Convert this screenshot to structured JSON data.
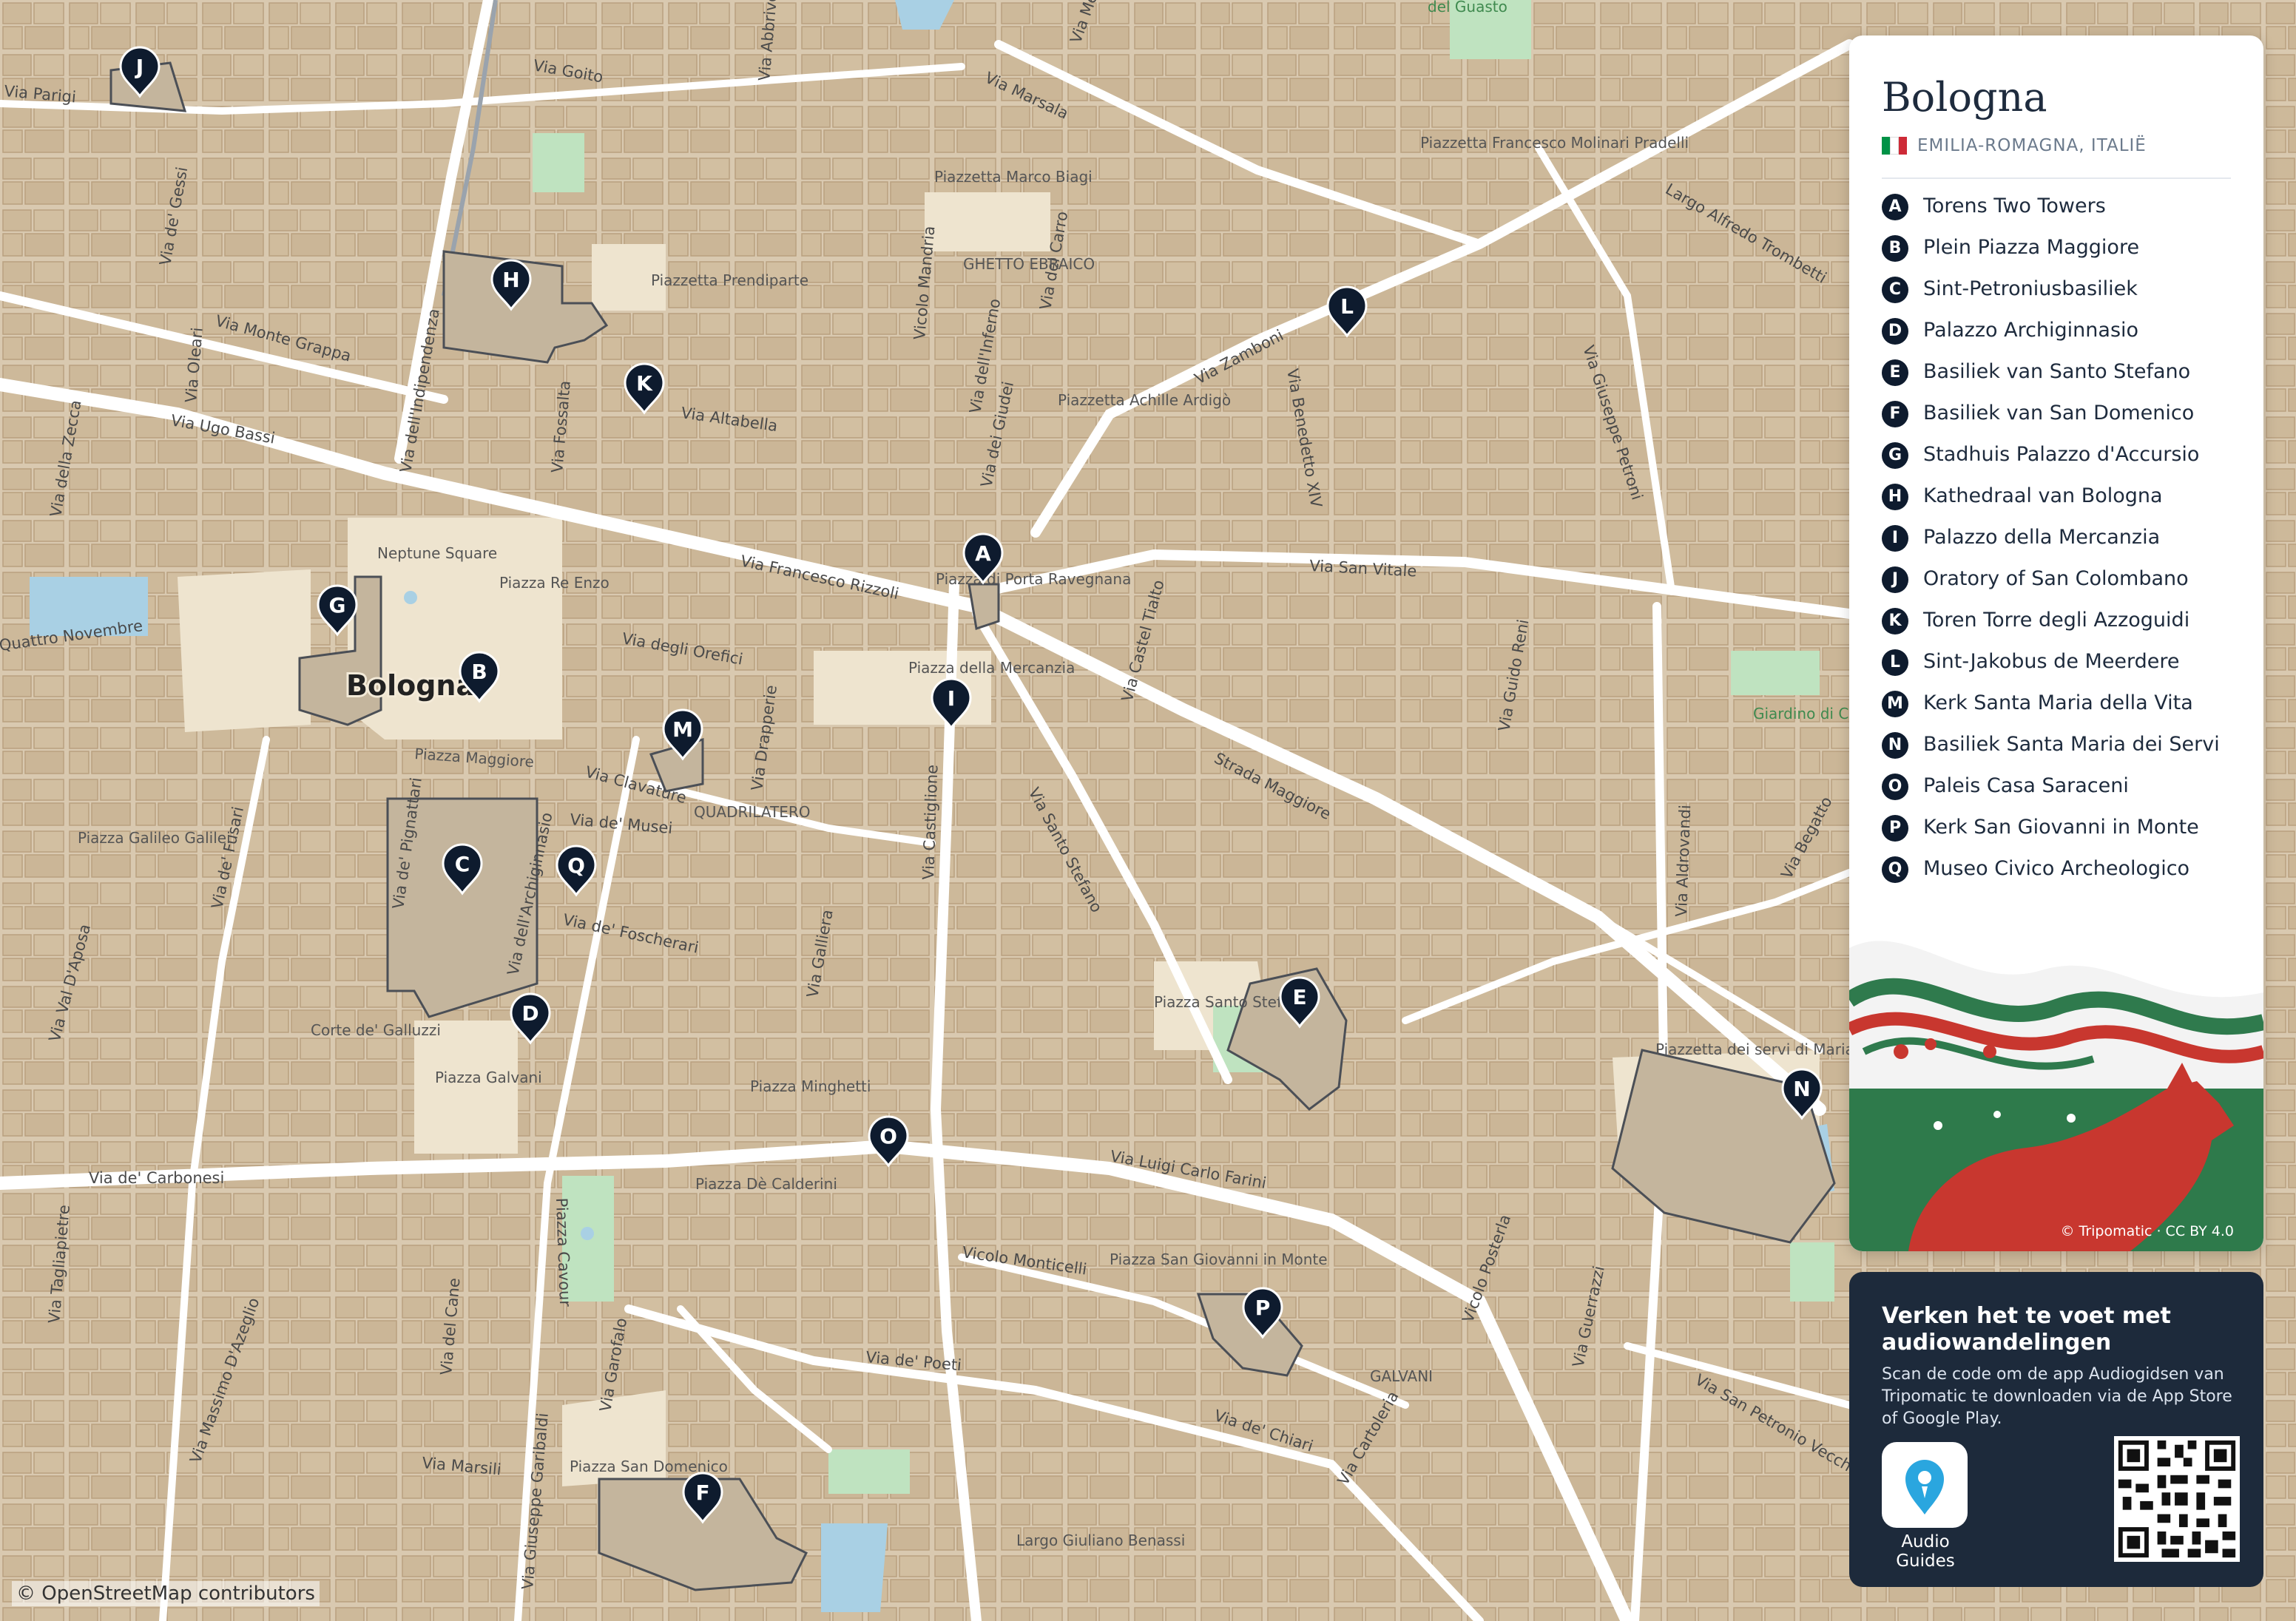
{
  "map": {
    "city_label": "Bologna",
    "attribution": "© OpenStreetMap contributors",
    "colors": {
      "land": "#d9c9b0",
      "street": "#ffffff",
      "building": "#c9b597",
      "park": "#bfe3c0",
      "water": "#a9d0e4",
      "marker": "#0e1b2e"
    },
    "street_labels": [
      "Via Goito",
      "Via Marsala",
      "Via Zamboni",
      "Via Altabella",
      "Via Ugo Bassi",
      "Via Francesco Rizzoli",
      "Via San Vitale",
      "Strada Maggiore",
      "Via Santo Stefano",
      "Via Castiglione",
      "Via Luigi Carlo Farini",
      "Via de' Carbonesi",
      "Via de' Poeti",
      "Via de' Chiari",
      "Via Marsili",
      "Via dell'Indipendenza",
      "Via Monte Grappa",
      "Via degli Orefici",
      "Via de' Musei",
      "Via Clavature",
      "Via de' Foscherari",
      "Via dell'Archiginnasio",
      "Via de' Pignattari",
      "Via Giuseppe Petroni",
      "Via Benedetto XIV",
      "Via Guido Reni",
      "Via Castel Tialto",
      "Largo Alfredo Trombetti",
      "Via de' Gessi",
      "Via Oleari",
      "Via della Zecca",
      "Via Galliera",
      "Via Fossalta",
      "Via Drapperie",
      "Vicolo Mandria",
      "Via dell'Inferno",
      "Via del Carro",
      "Via dei Giudei",
      "Vicolo Monticelli",
      "Via Cartoleria",
      "Via Guerrazzi",
      "Via San Petronio Vecchio",
      "Via Aldrovandi",
      "Via Begatto",
      "Vicolo Posterla",
      "Via Giuseppe Garibaldi",
      "Via Garofalo",
      "Via del Cane",
      "Piazza Cavour",
      "Via Massimo D'Azeglio",
      "Via Tagliapietre",
      "Via Val D'Aposa",
      "Via de' Fusari",
      "Via Parigi",
      "Via Abbrivoli",
      "Via Mentana",
      "Vicolo Posterla"
    ],
    "place_labels": [
      "Piazzetta Marco Biagi",
      "GHETTO EBRAICO",
      "Piazzetta Prendiparte",
      "Piazzetta Francesco Molinari Pradelli",
      "Piazzetta Achille Ardigò",
      "Neptune Square",
      "Piazza Re Enzo",
      "Piazza di Porta Ravegnana",
      "Piazza della Mercanzia",
      "Piazza Maggiore",
      "QUADRILATERO",
      "Piazza Galileo Galilei",
      "Corte de' Galluzzi",
      "Piazza Galvani",
      "Piazza Minghetti",
      "Piazza Santo Stefano",
      "Piazzetta dei servi di Maria",
      "Piazza Dè Calderini",
      "Piazza San Giovanni in Monte",
      "GALVANI",
      "Piazza San Domenico",
      "Largo Giuliano Benassi",
      "Giardino di Casa Tortore",
      "del Guasto",
      "Quattro Novembre"
    ],
    "markers": [
      "A",
      "B",
      "C",
      "D",
      "E",
      "F",
      "G",
      "H",
      "I",
      "J",
      "K",
      "L",
      "M",
      "N",
      "O",
      "P",
      "Q"
    ]
  },
  "panel": {
    "title": "Bologna",
    "subtitle": "EMILIA-ROMAGNA, ITALIË",
    "flag_colors": [
      "#009246",
      "#ffffff",
      "#ce2b37"
    ],
    "poi": [
      {
        "letter": "A",
        "name": "Torens Two Towers"
      },
      {
        "letter": "B",
        "name": "Plein Piazza Maggiore"
      },
      {
        "letter": "C",
        "name": "Sint-Petroniusbasiliek"
      },
      {
        "letter": "D",
        "name": "Palazzo Archiginnasio"
      },
      {
        "letter": "E",
        "name": "Basiliek van Santo Stefano"
      },
      {
        "letter": "F",
        "name": "Basiliek van San Domenico"
      },
      {
        "letter": "G",
        "name": "Stadhuis Palazzo d'Accursio"
      },
      {
        "letter": "H",
        "name": "Kathedraal van Bologna"
      },
      {
        "letter": "I",
        "name": "Palazzo della Mercanzia"
      },
      {
        "letter": "J",
        "name": "Oratory of San Colombano"
      },
      {
        "letter": "K",
        "name": "Toren Torre degli Azzoguidi"
      },
      {
        "letter": "L",
        "name": "Sint-Jakobus de Meerdere"
      },
      {
        "letter": "M",
        "name": "Kerk Santa Maria della Vita"
      },
      {
        "letter": "N",
        "name": "Basiliek Santa Maria dei Servi"
      },
      {
        "letter": "O",
        "name": "Paleis Casa Saraceni"
      },
      {
        "letter": "P",
        "name": "Kerk San Giovanni in Monte"
      },
      {
        "letter": "Q",
        "name": "Museo Civico Archeologico"
      }
    ],
    "credit": "© Tripomatic · CC BY 4.0"
  },
  "promo": {
    "title": "Verken het te voet met audiowandelingen",
    "body": "Scan de code om de app Audiogidsen van Tripomatic te downloaden via de App Store of Google Play.",
    "app_label": "Audio Guides",
    "app_icon": "map-pin-icon",
    "qr_icon": "qr-code"
  }
}
